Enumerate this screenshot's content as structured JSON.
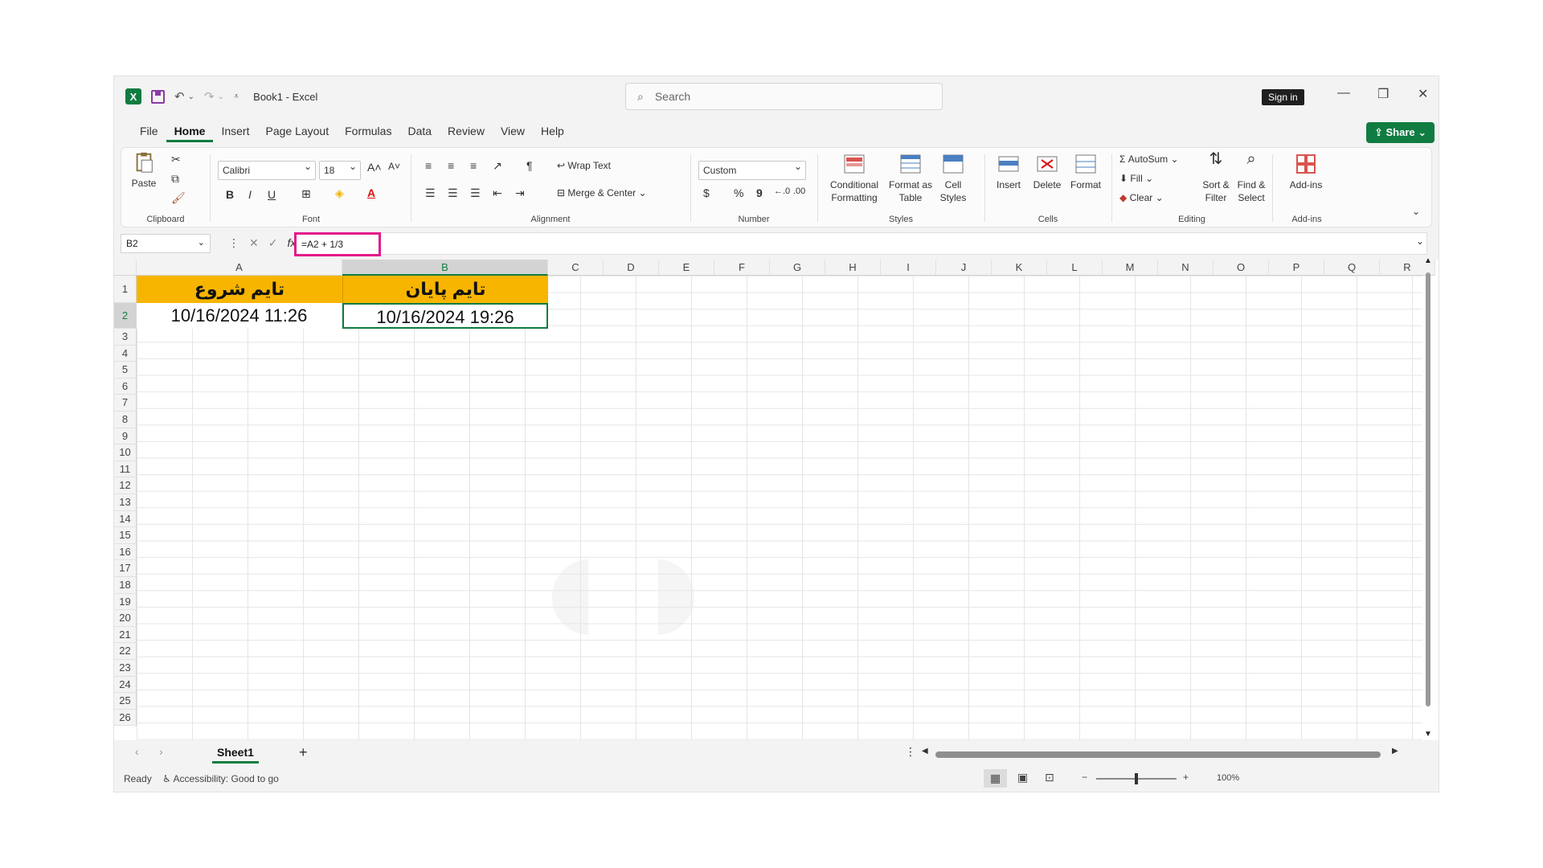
{
  "window": {
    "doc_title": "Book1  -  Excel",
    "search_placeholder": "Search",
    "signin_label": "Sign in",
    "share_label": "Share"
  },
  "menu": {
    "tabs": [
      "File",
      "Home",
      "Insert",
      "Page Layout",
      "Formulas",
      "Data",
      "Review",
      "View",
      "Help"
    ],
    "active": "Home"
  },
  "ribbon": {
    "clipboard": {
      "paste": "Paste",
      "label": "Clipboard"
    },
    "font": {
      "name": "Calibri",
      "size": "18",
      "label": "Font",
      "bold": "B",
      "italic": "I",
      "underline": "U"
    },
    "alignment": {
      "wrap": "Wrap Text",
      "merge": "Merge & Center",
      "label": "Alignment"
    },
    "number": {
      "format": "Custom",
      "currency": "$",
      "percent": "%",
      "comma": "9",
      "label": "Number"
    },
    "styles": {
      "conditional": "Conditional Formatting",
      "format_table": "Format as Table",
      "cell_styles": "Cell Styles",
      "label": "Styles"
    },
    "cells": {
      "insert": "Insert",
      "delete": "Delete",
      "format": "Format",
      "label": "Cells"
    },
    "editing": {
      "autosum": "AutoSum",
      "fill": "Fill",
      "clear": "Clear",
      "sort": "Sort & Filter",
      "find": "Find & Select",
      "label": "Editing"
    },
    "addins": {
      "addins": "Add-ins",
      "label": "Add-ins"
    }
  },
  "formula_bar": {
    "name_box": "B2",
    "fx": "fx",
    "formula": "=A2 + 1/3"
  },
  "sheet": {
    "columns": [
      "A",
      "B",
      "C",
      "D",
      "E",
      "F",
      "G",
      "H",
      "I",
      "J",
      "K",
      "L",
      "M",
      "N",
      "O",
      "P",
      "Q",
      "R"
    ],
    "rows": [
      "1",
      "2",
      "3",
      "4",
      "5",
      "6",
      "7",
      "8",
      "9",
      "10",
      "11",
      "12",
      "13",
      "14",
      "15",
      "16",
      "17",
      "18",
      "19",
      "20",
      "21",
      "22",
      "23",
      "24",
      "25",
      "26"
    ],
    "A1": "تایم شروع",
    "B1": "تایم پایان",
    "A2": "10/16/2024 11:26",
    "B2": "10/16/2024 19:26",
    "header_color": "#f7b500"
  },
  "tabs": {
    "sheet": "Sheet1",
    "add": "+"
  },
  "status": {
    "ready": "Ready",
    "accessibility": "Accessibility: Good to go",
    "zoom": "100%"
  }
}
